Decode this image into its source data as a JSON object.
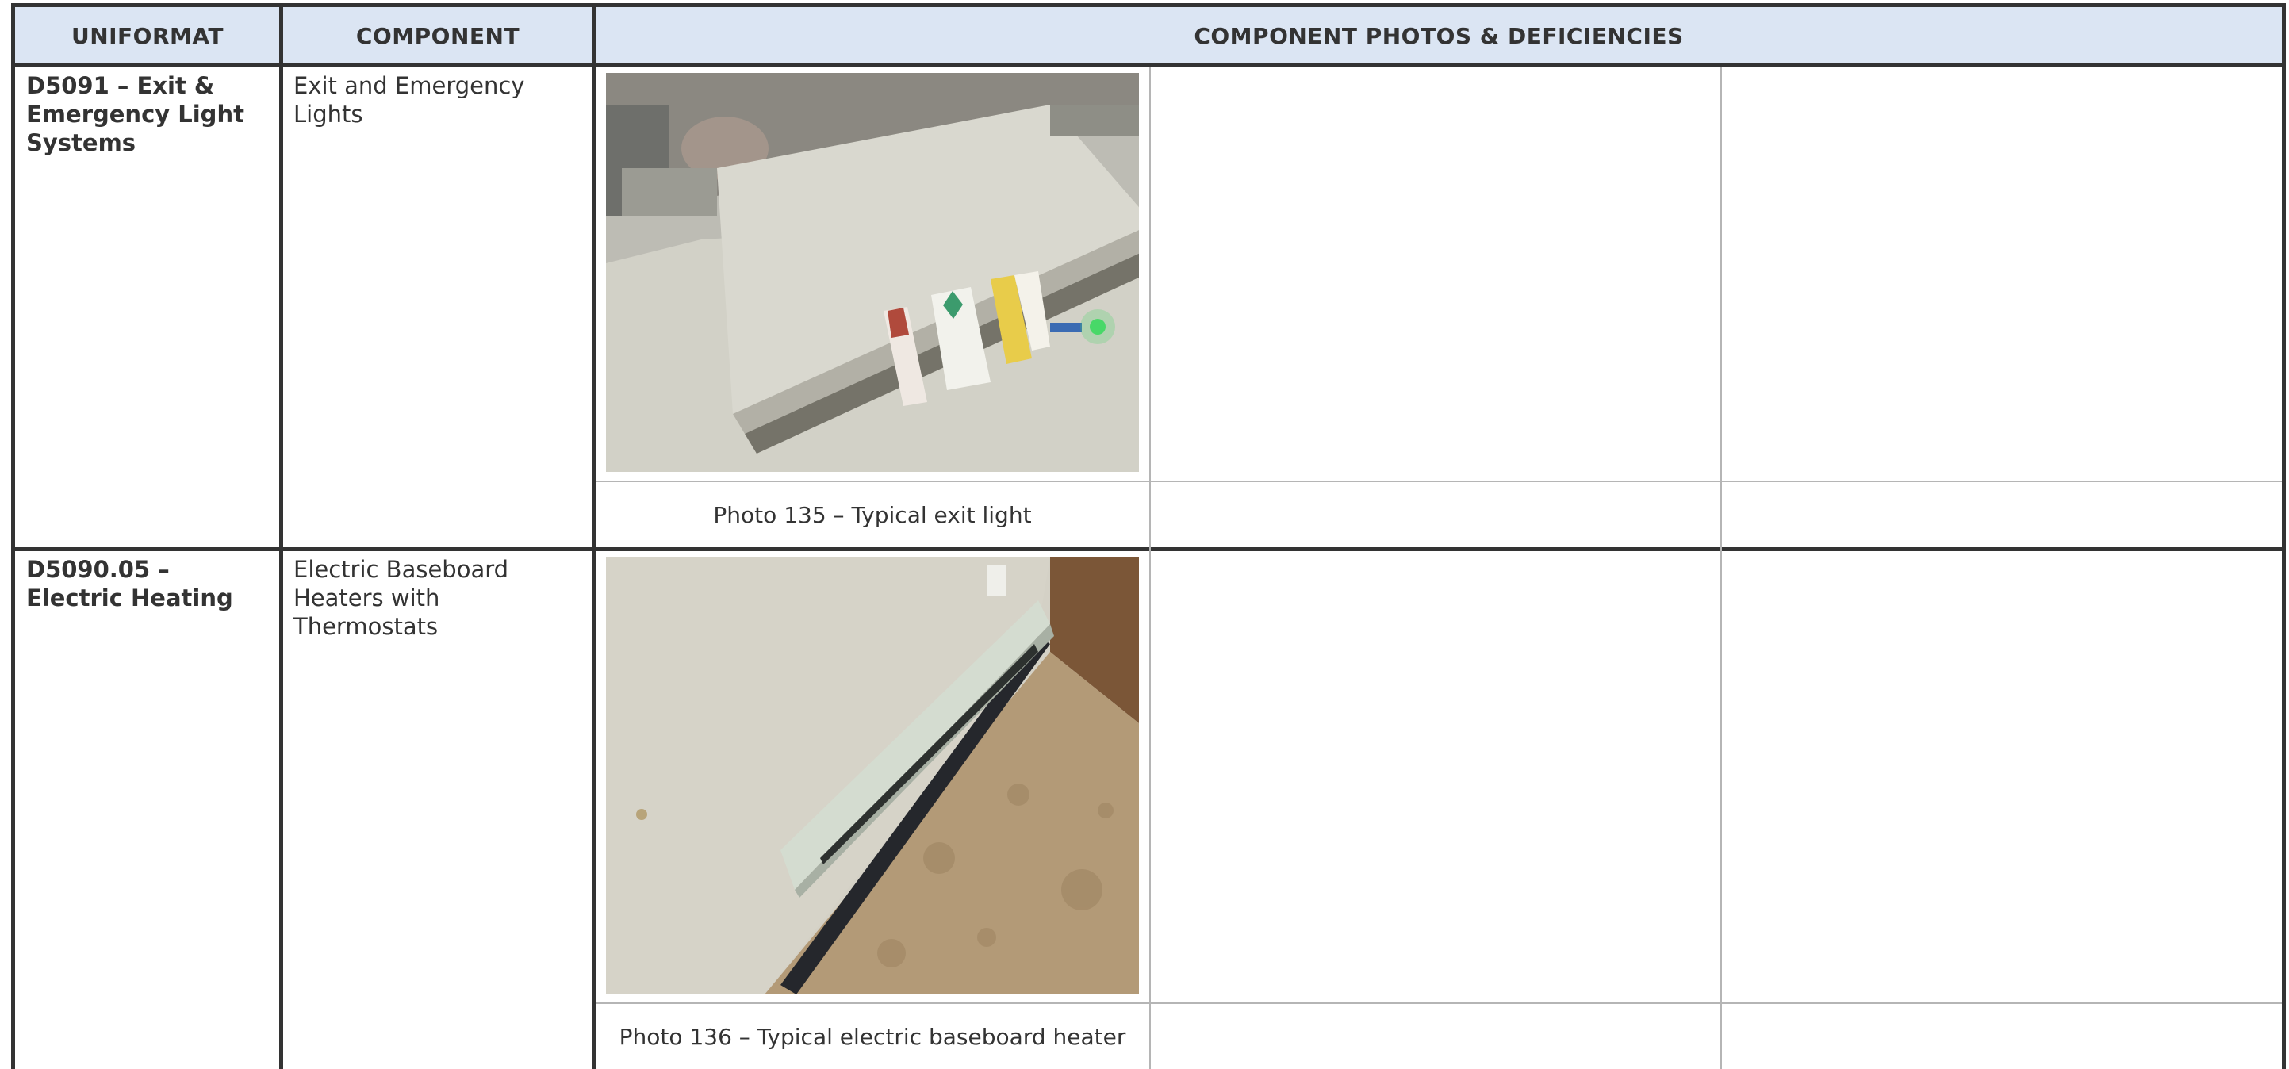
{
  "table": {
    "headers": {
      "uniformat": "UNIFORMAT",
      "component": "COMPONENT",
      "photos": "COMPONENT PHOTOS & DEFICIENCIES"
    },
    "rows": [
      {
        "uniformat": "D5091 – Exit & Emergency Light Systems",
        "component": "Exit and Emergency Lights",
        "photo_caption": "Photo 135 – Typical exit light"
      },
      {
        "uniformat": "D5090.05 – Electric Heating",
        "component": "Electric Baseboard Heaters with Thermostats",
        "photo_caption": "Photo 136 – Typical electric baseboard heater"
      }
    ]
  },
  "colors": {
    "header_bg": "#dbe5f3",
    "border": "#333333",
    "inner_border": "#b5b5b5"
  },
  "icons": [
    "exit-light-photo",
    "baseboard-heater-photo"
  ]
}
